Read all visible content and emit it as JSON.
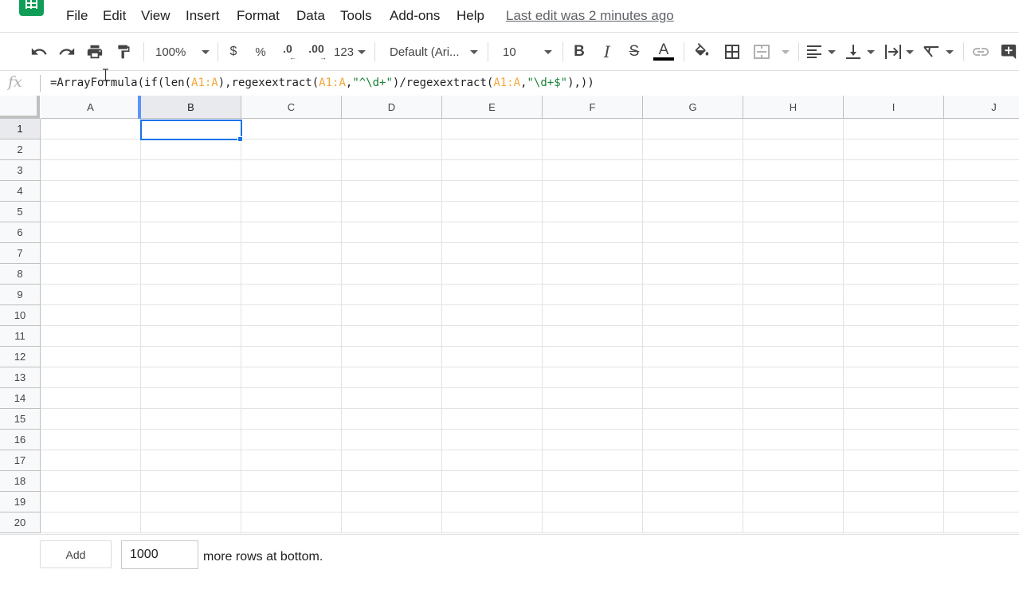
{
  "menubar": {
    "items": [
      "File",
      "Edit",
      "View",
      "Insert",
      "Format",
      "Data",
      "Tools",
      "Add-ons",
      "Help"
    ],
    "last_edit": "Last edit was 2 minutes ago"
  },
  "toolbar": {
    "zoom": "100%",
    "currency": "$",
    "percent": "%",
    "decrease_decimal": ".0",
    "increase_decimal": ".00",
    "more_formats": "123",
    "font": "Default (Ari...",
    "font_size": "10",
    "bold": "B",
    "italic": "I",
    "strikethrough": "S",
    "text_color": "A",
    "text_color_swatch": "#000000"
  },
  "formula_bar": {
    "fx": "fx",
    "formula_parts": [
      {
        "t": "=ArrayFormula(if(len(",
        "c": "plain"
      },
      {
        "t": "A1:A",
        "c": "range"
      },
      {
        "t": "),regexextract(",
        "c": "plain"
      },
      {
        "t": "A1:A",
        "c": "range"
      },
      {
        "t": ",",
        "c": "plain"
      },
      {
        "t": "\"^\\d+\"",
        "c": "str"
      },
      {
        "t": ")/regexextract(",
        "c": "plain"
      },
      {
        "t": "A1:A",
        "c": "range"
      },
      {
        "t": ",",
        "c": "plain"
      },
      {
        "t": "\"\\d+$\"",
        "c": "str"
      },
      {
        "t": "),))",
        "c": "plain"
      }
    ]
  },
  "grid": {
    "columns": [
      "A",
      "B",
      "C",
      "D",
      "E",
      "F",
      "G",
      "H",
      "I",
      "J"
    ],
    "rows": [
      "1",
      "2",
      "3",
      "4",
      "5",
      "6",
      "7",
      "8",
      "9",
      "10",
      "11",
      "12",
      "13",
      "14",
      "15",
      "16",
      "17",
      "18",
      "19",
      "20"
    ],
    "selected_column": "B",
    "selected_row": "1"
  },
  "footer": {
    "add_label": "Add",
    "rows_value": "1000",
    "rows_label": "more rows at bottom."
  },
  "colors": {
    "accent": "#1a73e8",
    "range_token": "#f4a53b",
    "string_token": "#188038",
    "logo": "#0f9d58"
  },
  "icons": [
    "sheets-logo-icon",
    "undo-icon",
    "redo-icon",
    "print-icon",
    "paint-format-icon",
    "fill-color-icon",
    "borders-icon",
    "merge-cells-icon",
    "align-left-icon",
    "valign-bottom-icon",
    "text-wrap-icon",
    "text-rotate-icon",
    "link-icon",
    "comment-icon",
    "fx-icon"
  ]
}
